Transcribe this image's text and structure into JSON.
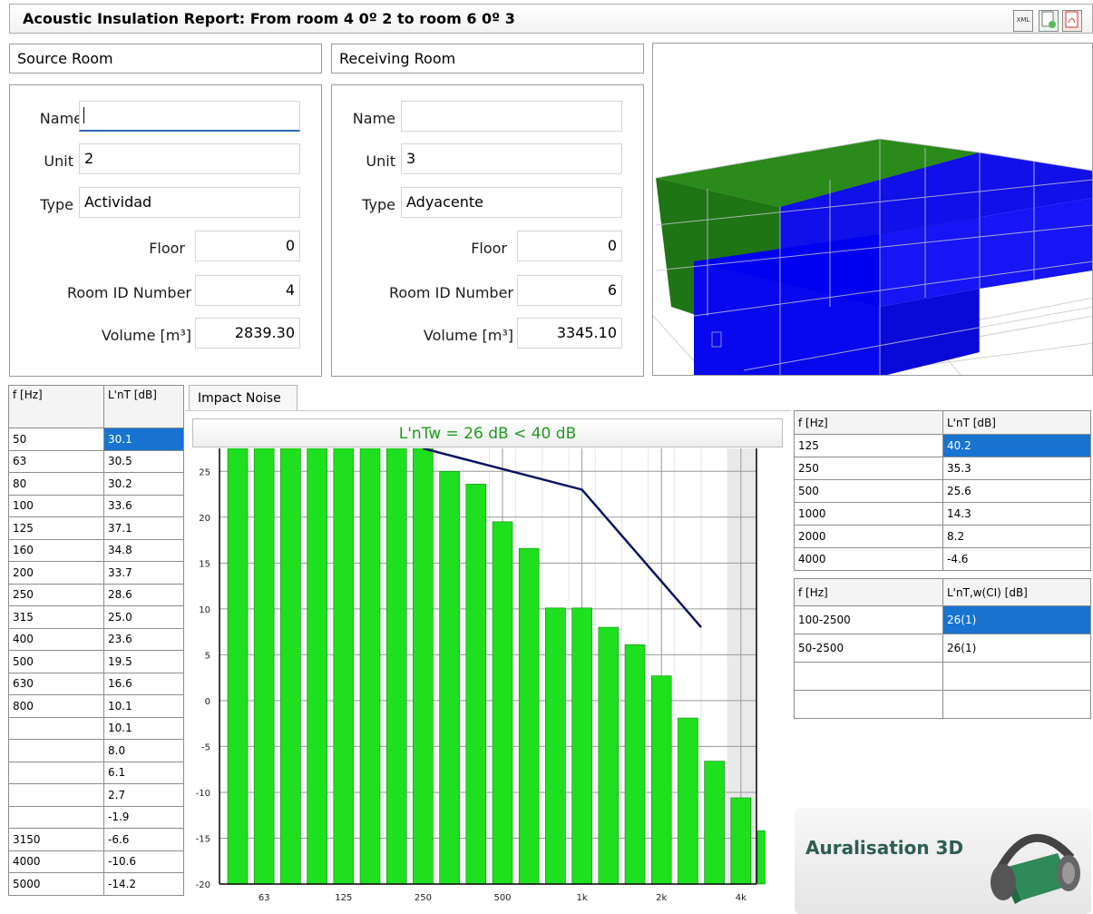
{
  "title": "Acoustic Insulation Report: From room 4  0º 2 to room 6  0º 3",
  "toolbar_icons": [
    "xml-icon",
    "export-icon",
    "pdf-icon"
  ],
  "source": {
    "header": "Source Room",
    "name_label": "Name",
    "name_value": "",
    "unit_label": "Unit",
    "unit_value": "2",
    "type_label": "Type",
    "type_value": "Actividad",
    "floor_label": "Floor",
    "floor_value": "0",
    "roomid_label": "Room ID Number",
    "roomid_value": "4",
    "volume_label": "Volume [m³]",
    "volume_value": "2839.30"
  },
  "receiving": {
    "header": "Receiving Room",
    "name_label": "Name",
    "name_value": "",
    "unit_label": "Unit",
    "unit_value": "3",
    "type_label": "Type",
    "type_value": "Adyacente",
    "floor_label": "Floor",
    "floor_value": "0",
    "roomid_label": "Room ID Number",
    "roomid_value": "6",
    "volume_label": "Volume [m³]",
    "volume_value": "3345.10"
  },
  "third_octave_table": {
    "headers": [
      "f [Hz]",
      "L'nT [dB]"
    ],
    "rows": [
      [
        "50",
        "30.1"
      ],
      [
        "63",
        "30.5"
      ],
      [
        "80",
        "30.2"
      ],
      [
        "100",
        "33.6"
      ],
      [
        "125",
        "37.1"
      ],
      [
        "160",
        "34.8"
      ],
      [
        "200",
        "33.7"
      ],
      [
        "250",
        "28.6"
      ],
      [
        "315",
        "25.0"
      ],
      [
        "400",
        "23.6"
      ],
      [
        "500",
        "19.5"
      ],
      [
        "630",
        "16.6"
      ],
      [
        "800",
        "10.1"
      ],
      [
        "",
        "10.1"
      ],
      [
        "",
        "8.0"
      ],
      [
        "",
        "6.1"
      ],
      [
        "",
        "2.7"
      ],
      [
        "",
        "-1.9"
      ],
      [
        "3150",
        "-6.6"
      ],
      [
        "4000",
        "-10.6"
      ],
      [
        "5000",
        "-14.2"
      ]
    ]
  },
  "tab_label": "Impact Noise",
  "rating_text": "L'nTw = 26 dB < 40 dB",
  "colors": {
    "bar": "#1ee01e",
    "reference": "#0a1560",
    "selection": "#1874d0",
    "rating": "#1e9a1e"
  },
  "chart_data": {
    "type": "bar",
    "categories": [
      "50",
      "63",
      "80",
      "100",
      "125",
      "160",
      "200",
      "250",
      "315",
      "400",
      "500",
      "630",
      "800",
      "1000",
      "1250",
      "1600",
      "2000",
      "2500",
      "3150",
      "4000",
      "5000"
    ],
    "series": [
      {
        "values": [
          30.1,
          30.5,
          30.2,
          33.6,
          37.1,
          34.8,
          33.7,
          28.6,
          25.0,
          23.6,
          19.5,
          16.6,
          10.1,
          10.1,
          8.0,
          6.1,
          2.7,
          -1.9,
          -6.6,
          -10.6,
          -14.2
        ]
      }
    ],
    "reference_curve": {
      "x_index": [
        7,
        13,
        17.5
      ],
      "values": [
        27.5,
        23,
        8
      ]
    },
    "x_tick_labels": [
      "63",
      "125",
      "250",
      "500",
      "1k",
      "2k",
      "4k"
    ],
    "x_tick_index": [
      1,
      4,
      7,
      10,
      13,
      16,
      19
    ],
    "y_ticks": [
      25,
      20,
      15,
      10,
      5,
      0,
      -5,
      -10,
      -15,
      -20
    ],
    "ylim": [
      -20,
      27.5
    ],
    "grid": true,
    "shaded_from_index": 18.5
  },
  "octave_table": {
    "headers": [
      "f [Hz]",
      "L'nT [dB]"
    ],
    "rows": [
      [
        "125",
        "40.2"
      ],
      [
        "250",
        "35.3"
      ],
      [
        "500",
        "25.6"
      ],
      [
        "1000",
        "14.3"
      ],
      [
        "2000",
        "8.2"
      ],
      [
        "4000",
        "-4.6"
      ]
    ]
  },
  "weighted_table": {
    "headers": [
      "f [Hz]",
      "L'nT,w(CI) [dB]"
    ],
    "rows": [
      [
        "100-2500",
        "26(1)"
      ],
      [
        "50-2500",
        "26(1)"
      ],
      [
        "",
        ""
      ],
      [
        "",
        ""
      ]
    ]
  },
  "auralisation_label": "Auralisation 3D"
}
